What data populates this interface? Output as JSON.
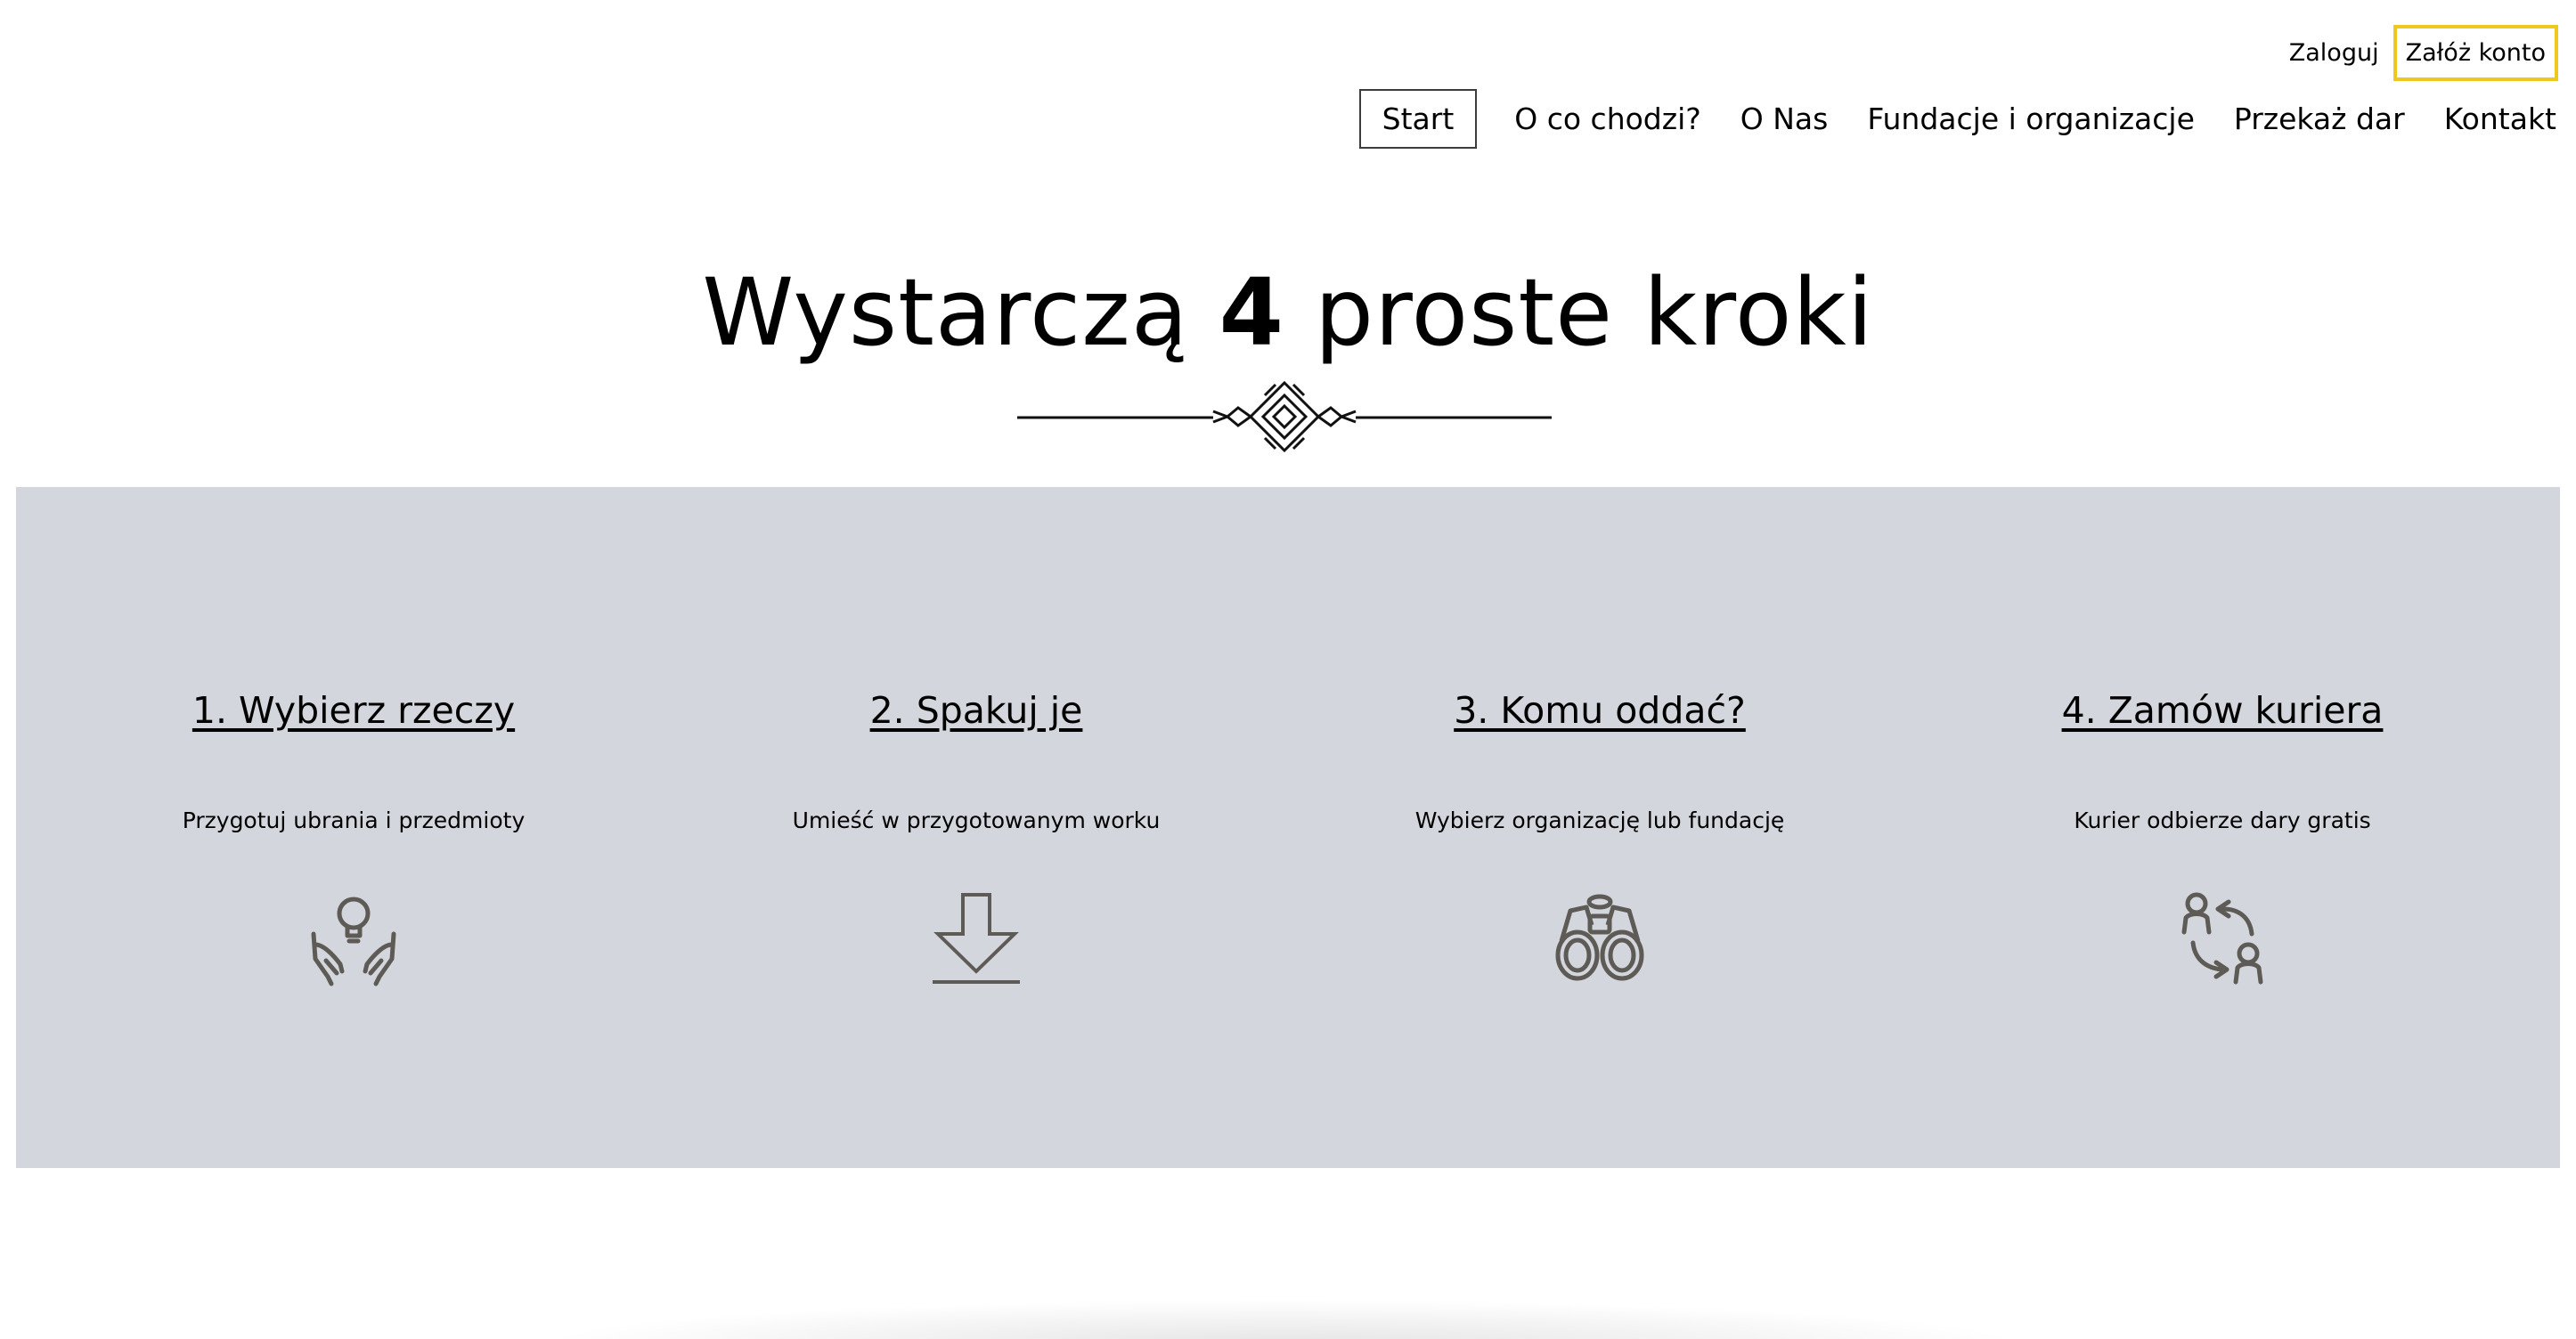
{
  "auth": {
    "login_label": "Zaloguj",
    "register_label": "Załóż konto",
    "register_border_color": "#F0C71E"
  },
  "nav": {
    "items": [
      {
        "label": "Start",
        "active": true
      },
      {
        "label": "O co chodzi?",
        "active": false
      },
      {
        "label": "O Nas",
        "active": false
      },
      {
        "label": "Fundacje i organizacje",
        "active": false
      },
      {
        "label": "Przekaż dar",
        "active": false
      },
      {
        "label": "Kontakt",
        "active": false
      }
    ]
  },
  "heading": {
    "before": "Wystarczą ",
    "number": "4",
    "after": " proste kroki"
  },
  "steps_band": {
    "background": "#D3D6DD"
  },
  "steps": [
    {
      "title": "1. Wybierz rzeczy",
      "description": "Przygotuj ubrania i przedmioty",
      "icon": "hands-lightbulb-icon"
    },
    {
      "title": "2. Spakuj je",
      "description": "Umieść w przygotowanym worku",
      "icon": "download-arrow-icon"
    },
    {
      "title": "3. Komu oddać?",
      "description": "Wybierz organizację lub fundację",
      "icon": "binoculars-icon"
    },
    {
      "title": "4. Zamów kuriera",
      "description": "Kurier odbierze dary gratis",
      "icon": "people-exchange-icon"
    }
  ],
  "colors": {
    "icon": "#5E5A55",
    "text": "#000000"
  }
}
